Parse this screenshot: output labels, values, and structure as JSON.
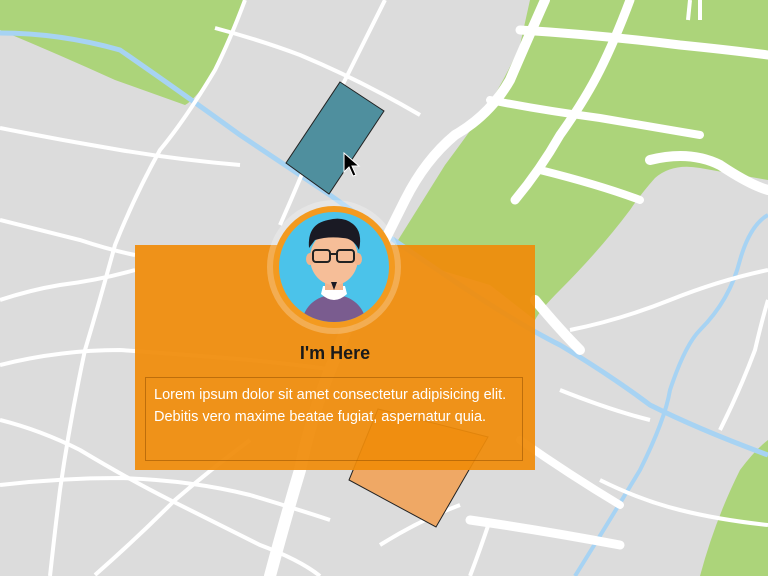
{
  "marker": {
    "title": "I'm Here",
    "description": "Lorem ipsum dolor sit amet consectetur adipisicing elit. Debitis vero maxime beatae fugiat, aspernatur quia.",
    "avatar_icon": "person-avatar-icon"
  },
  "colors": {
    "land": "#dcdcdc",
    "park": "#acd47a",
    "road": "#ffffff",
    "river": "#a7d3f3",
    "popup": "#f08c0a",
    "building_teal": "#4f8f9e",
    "building_orange": "#efa865"
  }
}
